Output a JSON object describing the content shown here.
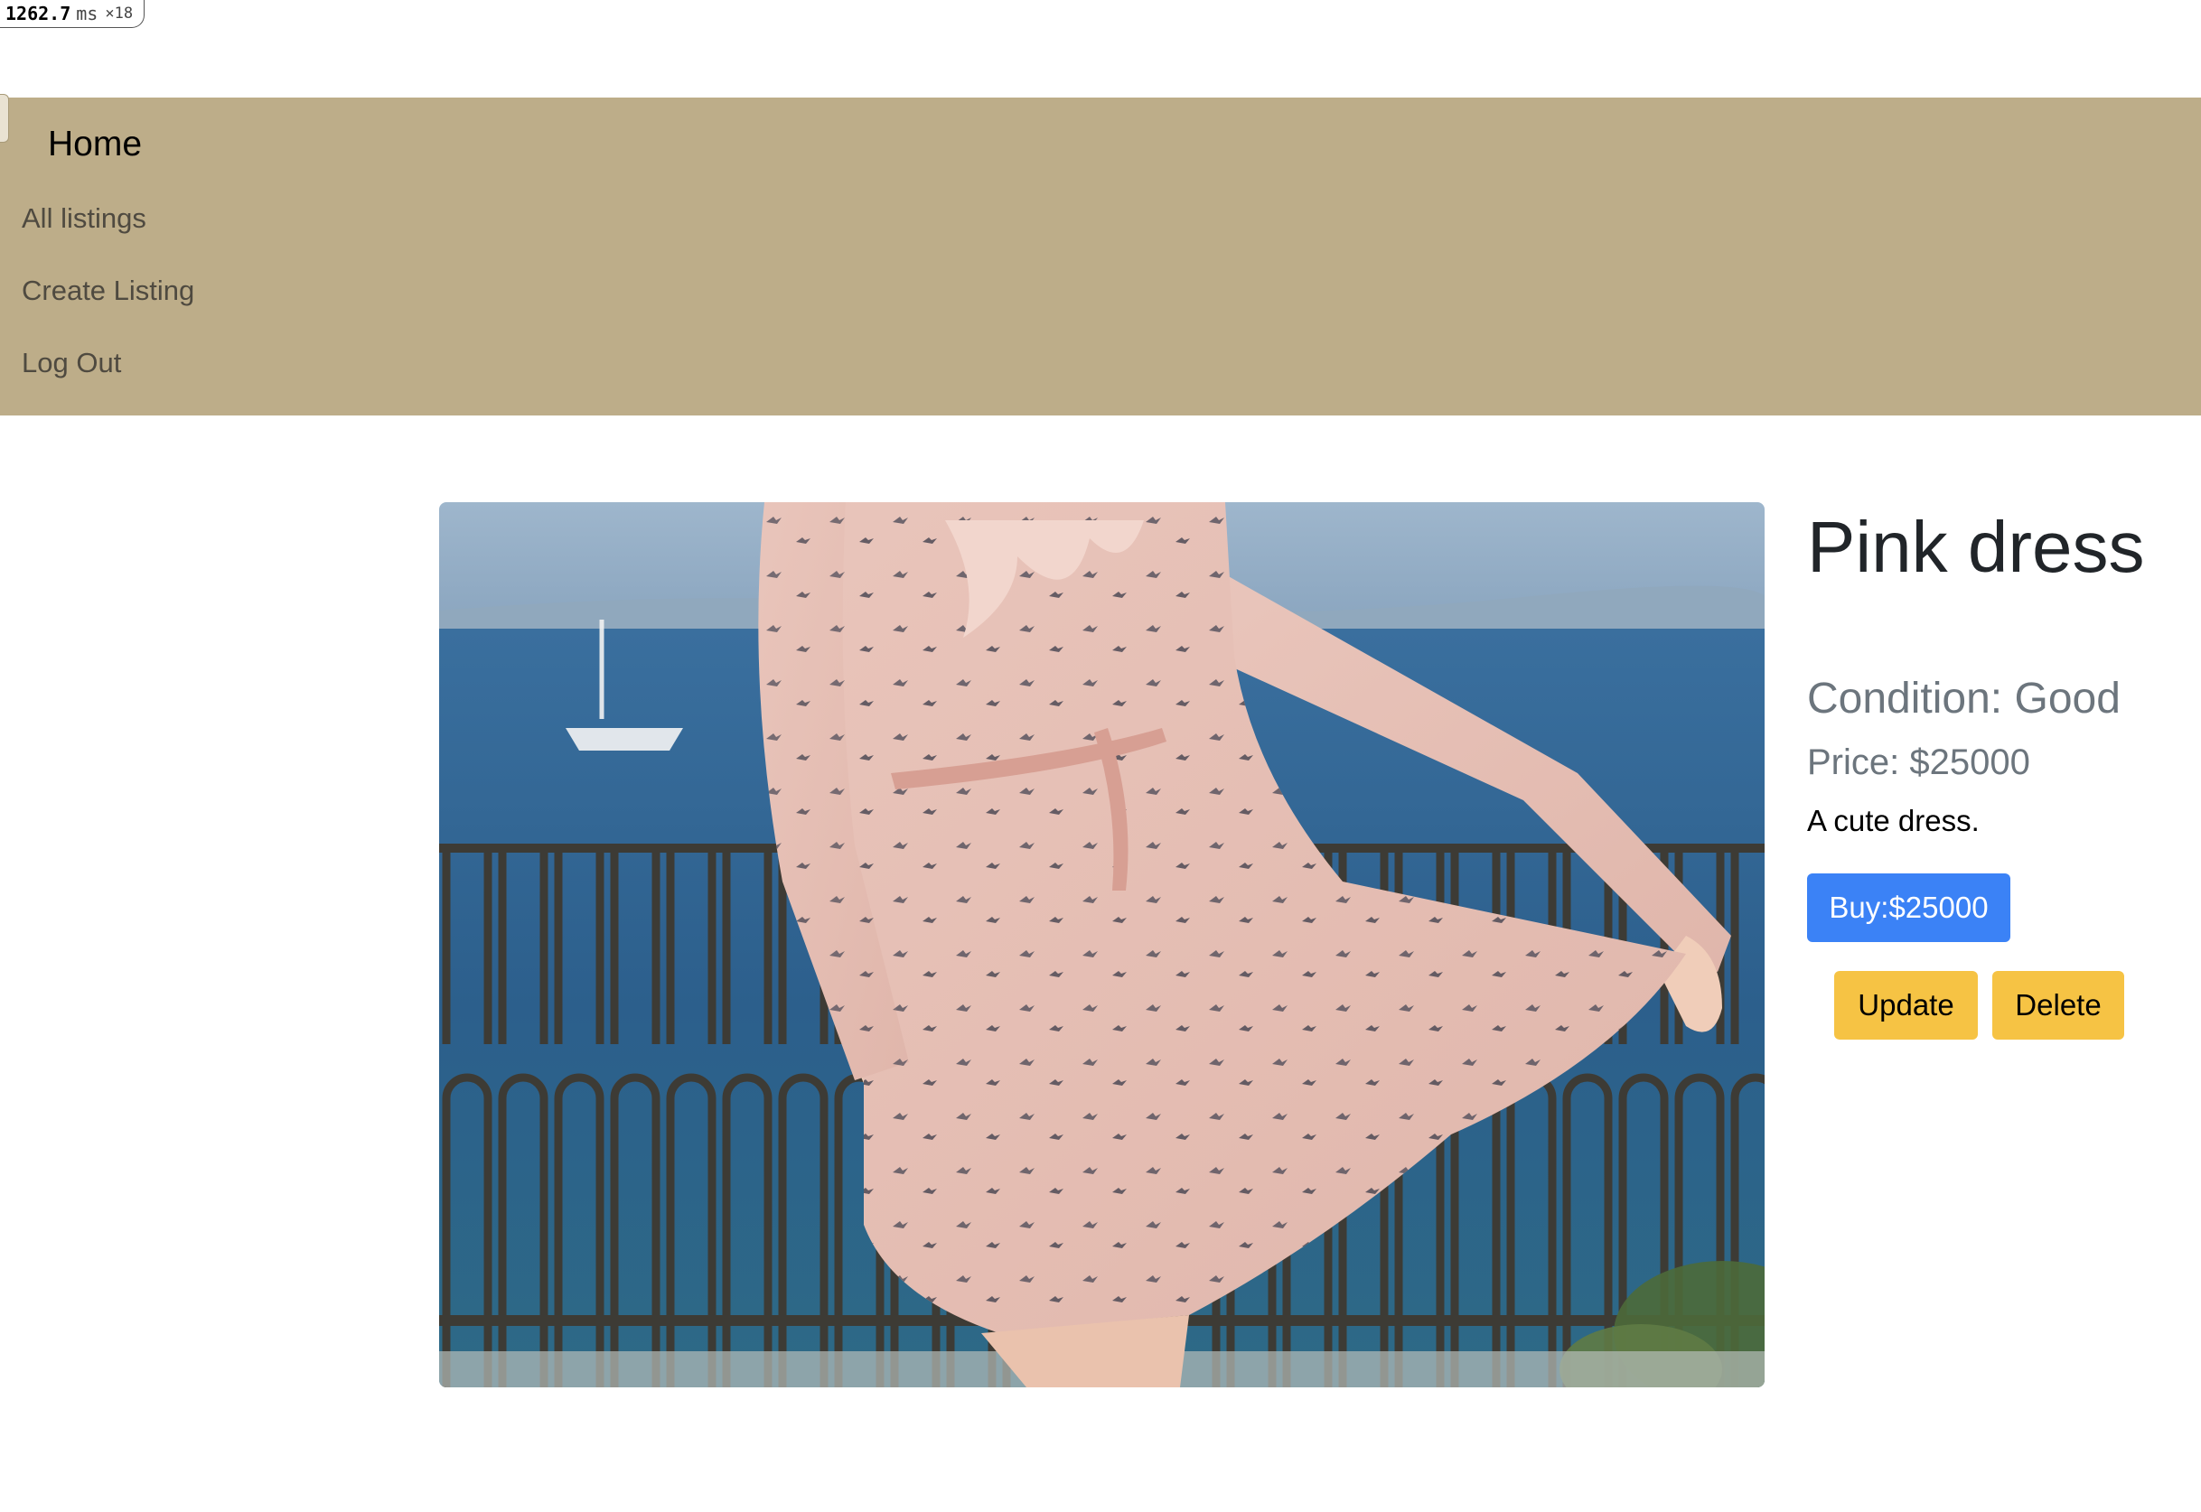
{
  "perf_overlay": {
    "value": "1262.7",
    "unit": "ms",
    "multiplier": "×18"
  },
  "navbar": {
    "brand": "Home",
    "links": [
      "All listings",
      "Create Listing",
      "Log Out"
    ],
    "background_color": "#bdad89"
  },
  "listing": {
    "title": "Pink dress",
    "condition": "Condition: Good",
    "price": "Price: $25000",
    "description": "A cute dress.",
    "buy_label": "Buy:$25000",
    "update_label": "Update",
    "delete_label": "Delete",
    "buy_color": "#3b82f6",
    "action_color": "#f6c344"
  }
}
